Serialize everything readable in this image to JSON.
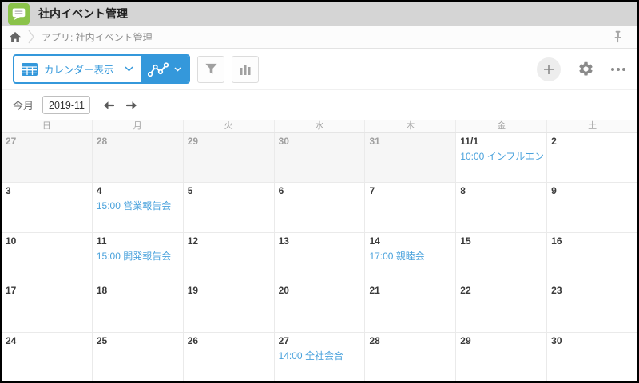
{
  "appearance": {
    "accent_blue": "#3498db",
    "event_link_blue": "#4aa2dc",
    "app_icon_green": "#8bc34a",
    "topbar_gray": "#d5d5d5"
  },
  "header": {
    "app_title": "社内イベント管理",
    "app_icon": "speech-bubble-icon"
  },
  "breadcrumb": {
    "home_icon": "home-icon",
    "label": "アプリ: 社内イベント管理",
    "pin_icon": "pushpin-icon"
  },
  "toolbar": {
    "view_selector": {
      "icon": "table-grid-icon",
      "label": "カレンダー表示",
      "chevron": "chevron-down-icon"
    },
    "graph_button": {
      "icon": "line-graph-icon",
      "chevron": "chevron-down-icon"
    },
    "filter_button": {
      "icon": "funnel-icon"
    },
    "chart_button": {
      "icon": "bar-chart-icon"
    },
    "add_record_button": {
      "icon": "plus-icon"
    },
    "settings_button": {
      "icon": "gear-icon"
    },
    "more_button": {
      "icon": "ellipsis-icon"
    }
  },
  "date_nav": {
    "scope_label": "今月",
    "month_value": "2019-11",
    "prev_icon": "arrow-left-icon",
    "next_icon": "arrow-right-icon"
  },
  "calendar": {
    "weekdays": [
      "日",
      "月",
      "火",
      "水",
      "木",
      "金",
      "土"
    ],
    "weeks": [
      [
        {
          "d": "27",
          "out": true
        },
        {
          "d": "28",
          "out": true
        },
        {
          "d": "29",
          "out": true
        },
        {
          "d": "30",
          "out": true
        },
        {
          "d": "31",
          "out": true
        },
        {
          "d": "11/1",
          "ev": "10:00 インフルエン…"
        },
        {
          "d": "2"
        }
      ],
      [
        {
          "d": "3"
        },
        {
          "d": "4",
          "ev": "15:00 営業報告会"
        },
        {
          "d": "5"
        },
        {
          "d": "6"
        },
        {
          "d": "7"
        },
        {
          "d": "8"
        },
        {
          "d": "9"
        }
      ],
      [
        {
          "d": "10"
        },
        {
          "d": "11",
          "ev": "15:00 開発報告会"
        },
        {
          "d": "12"
        },
        {
          "d": "13"
        },
        {
          "d": "14",
          "ev": "17:00 親睦会"
        },
        {
          "d": "15"
        },
        {
          "d": "16"
        }
      ],
      [
        {
          "d": "17"
        },
        {
          "d": "18"
        },
        {
          "d": "19"
        },
        {
          "d": "20"
        },
        {
          "d": "21"
        },
        {
          "d": "22"
        },
        {
          "d": "23"
        }
      ],
      [
        {
          "d": "24"
        },
        {
          "d": "25"
        },
        {
          "d": "26"
        },
        {
          "d": "27",
          "ev": "14:00 全社会合"
        },
        {
          "d": "28"
        },
        {
          "d": "29"
        },
        {
          "d": "30"
        }
      ]
    ]
  }
}
